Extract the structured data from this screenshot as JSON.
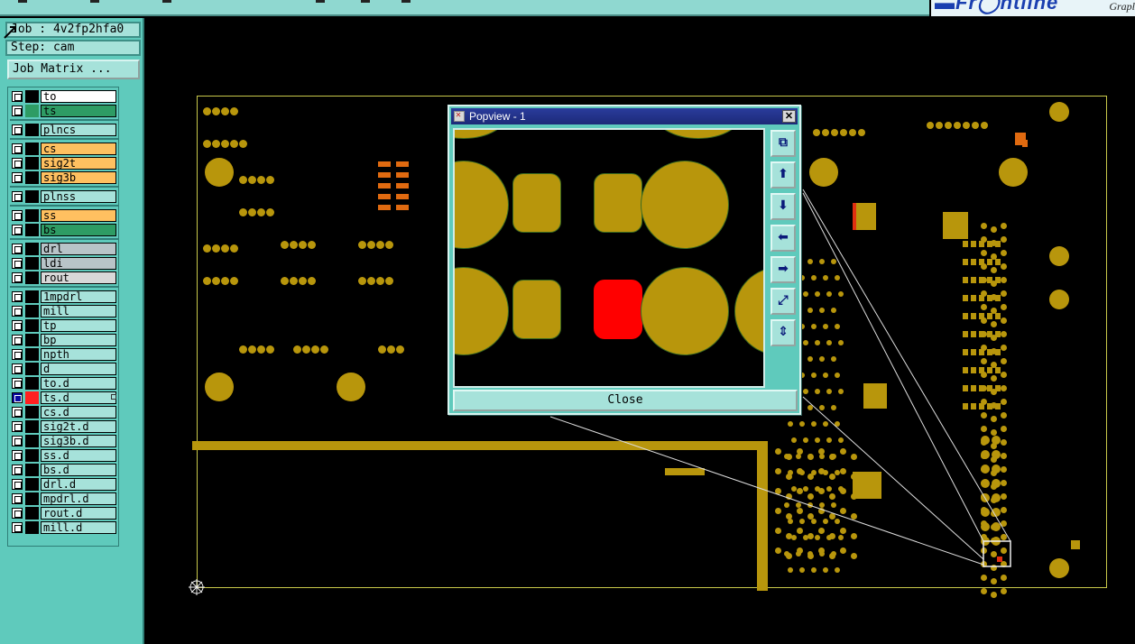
{
  "window": {
    "brand_tail": "Grapl"
  },
  "info": {
    "job": "Job : 4v2fp2hfa0",
    "step": "Step: cam",
    "job_matrix": "Job Matrix ..."
  },
  "layers": [
    {
      "name": "to",
      "color": "#ffffff",
      "swatch": "#000000"
    },
    {
      "name": "ts",
      "color": "#2e9c64",
      "swatch": "#2e9c64"
    },
    {
      "name": "plncs",
      "color": "#a6e2da",
      "swatch": "#000000"
    },
    {
      "name": "cs",
      "color": "#ffc060",
      "swatch": "#000000"
    },
    {
      "name": "sig2t",
      "color": "#ffc060",
      "swatch": "#000000"
    },
    {
      "name": "sig3b",
      "color": "#ffc060",
      "swatch": "#000000"
    },
    {
      "name": "plnss",
      "color": "#a6e2da",
      "swatch": "#000000"
    },
    {
      "name": "ss",
      "color": "#ffc060",
      "swatch": "#000000"
    },
    {
      "name": "bs",
      "color": "#2e9c64",
      "swatch": "#000000"
    },
    {
      "name": "drl",
      "color": "#b8c4c8",
      "swatch": "#000000"
    },
    {
      "name": "ldi",
      "color": "#b8c4c8",
      "swatch": "#000000"
    },
    {
      "name": "rout",
      "color": "#d8d8d8",
      "swatch": "#000000"
    },
    {
      "name": "1mpdrl",
      "color": "#a6e2da",
      "swatch": "#000000"
    },
    {
      "name": "mill",
      "color": "#a6e2da",
      "swatch": "#000000"
    },
    {
      "name": "tp",
      "color": "#a6e2da",
      "swatch": "#000000"
    },
    {
      "name": "bp",
      "color": "#a6e2da",
      "swatch": "#000000"
    },
    {
      "name": "npth",
      "color": "#a6e2da",
      "swatch": "#000000"
    },
    {
      "name": "d",
      "color": "#a6e2da",
      "swatch": "#000000"
    },
    {
      "name": "to.d",
      "color": "#a6e2da",
      "swatch": "#000000"
    },
    {
      "name": "ts.d",
      "color": "#a6e2da",
      "swatch": "#ff2020",
      "active": true
    },
    {
      "name": "cs.d",
      "color": "#a6e2da",
      "swatch": "#000000"
    },
    {
      "name": "sig2t.d",
      "color": "#a6e2da",
      "swatch": "#000000"
    },
    {
      "name": "sig3b.d",
      "color": "#a6e2da",
      "swatch": "#000000"
    },
    {
      "name": "ss.d",
      "color": "#a6e2da",
      "swatch": "#000000"
    },
    {
      "name": "bs.d",
      "color": "#a6e2da",
      "swatch": "#000000"
    },
    {
      "name": "drl.d",
      "color": "#a6e2da",
      "swatch": "#000000"
    },
    {
      "name": "mpdrl.d",
      "color": "#a6e2da",
      "swatch": "#000000"
    },
    {
      "name": "rout.d",
      "color": "#a6e2da",
      "swatch": "#000000"
    },
    {
      "name": "mill.d",
      "color": "#a6e2da",
      "swatch": "#000000"
    }
  ],
  "popview": {
    "title": "Popview - 1",
    "close_label": "Close",
    "tools": [
      "zoom-fit-icon",
      "pan-up-icon",
      "pan-down-icon",
      "pan-left-icon",
      "pan-right-icon",
      "zoom-in-icon",
      "zoom-out-icon"
    ]
  },
  "colors": {
    "panel": "#5fcabc",
    "field": "#a6e2da",
    "copper": "#b8960c",
    "highlight": "#ff0000",
    "outline": "#c8c84a"
  }
}
